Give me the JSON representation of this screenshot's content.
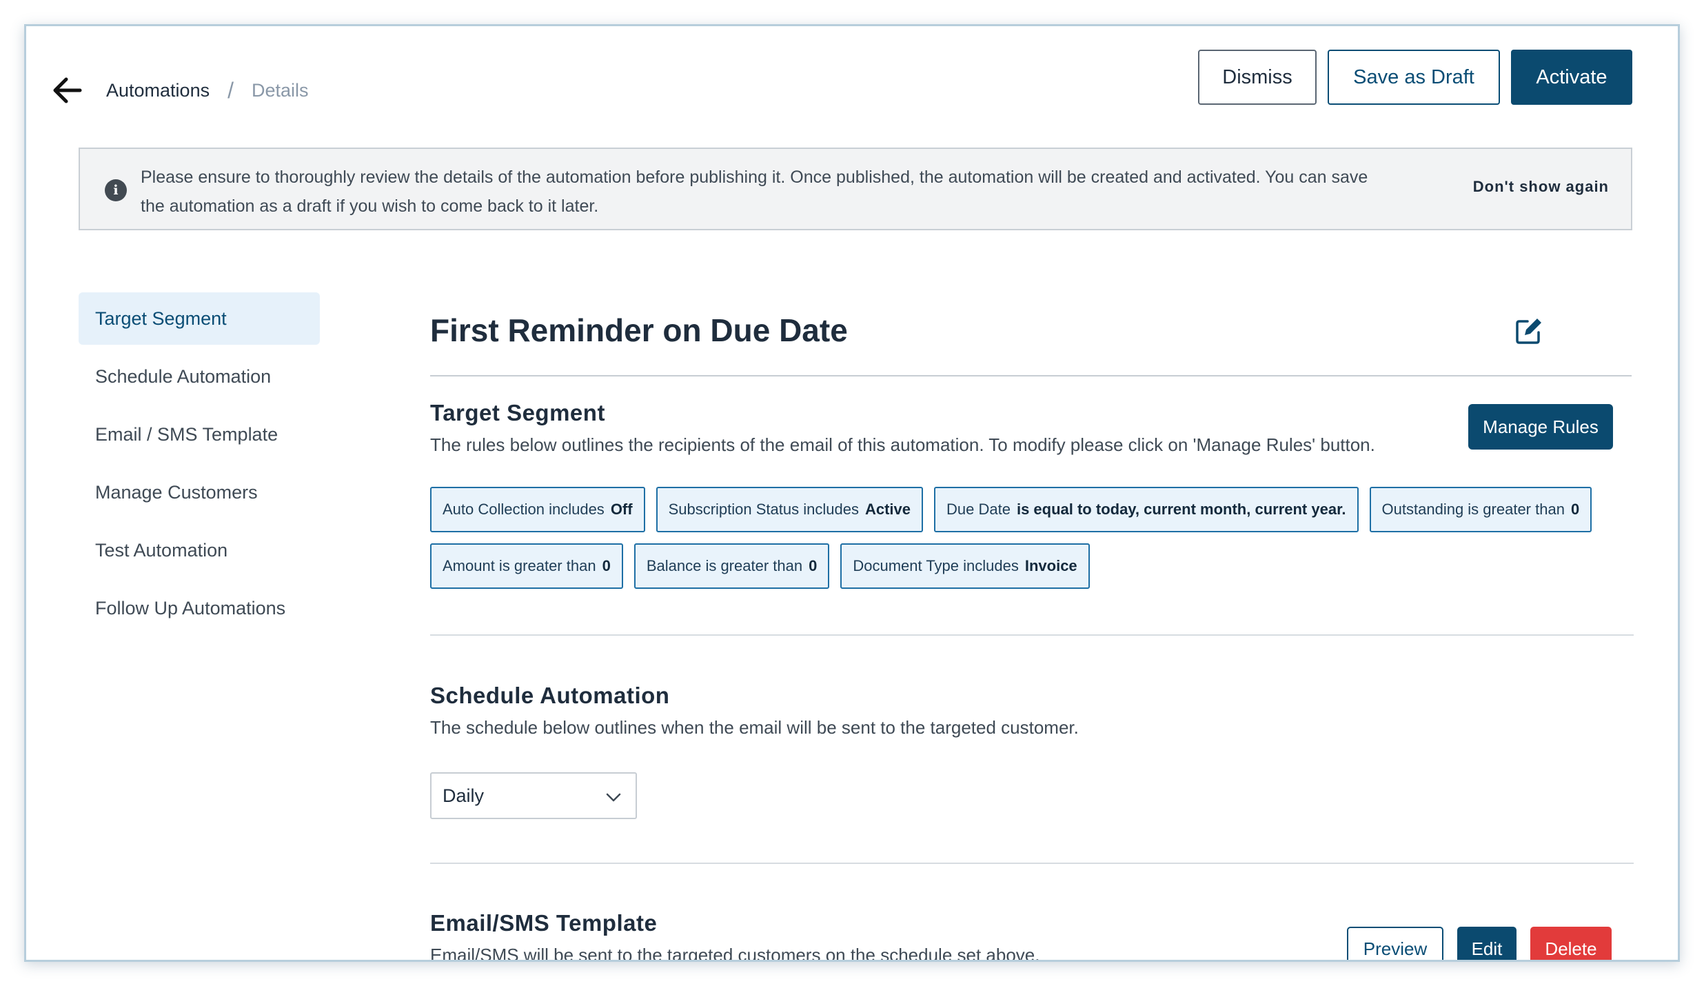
{
  "header": {
    "breadcrumb": {
      "parent": "Automations",
      "separator": "/",
      "current": "Details"
    },
    "buttons": {
      "dismiss": "Dismiss",
      "save_draft": "Save as Draft",
      "activate": "Activate"
    }
  },
  "banner": {
    "icon": "info-icon",
    "text": "Please ensure to thoroughly review the details of the automation before publishing it. Once published, the automation will be created and activated. You can save the automation as a draft if you wish to come back to it later.",
    "dismiss": "Don't show again"
  },
  "sidebar": {
    "items": [
      {
        "label": "Target Segment",
        "active": true
      },
      {
        "label": "Schedule Automation",
        "active": false
      },
      {
        "label": "Email / SMS Template",
        "active": false
      },
      {
        "label": "Manage Customers",
        "active": false
      },
      {
        "label": "Test Automation",
        "active": false
      },
      {
        "label": "Follow Up Automations",
        "active": false
      }
    ]
  },
  "main": {
    "title": "First Reminder on Due Date",
    "target_segment": {
      "title": "Target Segment",
      "description": "The rules below outlines the recipients of the email of this automation. To modify please click on 'Manage Rules' button.",
      "manage_rules": "Manage Rules",
      "rules": [
        {
          "label": "Auto Collection includes",
          "value": "Off"
        },
        {
          "label": "Subscription Status includes",
          "value": "Active"
        },
        {
          "label": "Due Date",
          "value": "is equal to today, current month, current year."
        },
        {
          "label": "Outstanding is greater than",
          "value": "0"
        },
        {
          "label": "Amount is greater than",
          "value": "0"
        },
        {
          "label": "Balance is greater than",
          "value": "0"
        },
        {
          "label": "Document Type includes",
          "value": "Invoice"
        }
      ]
    },
    "schedule": {
      "title": "Schedule Automation",
      "description": "The schedule below outlines when the email will be sent to the targeted customer.",
      "frequency": "Daily"
    },
    "template": {
      "title": "Email/SMS Template",
      "description": "Email/SMS will be sent to the targeted customers on the schedule set above.",
      "preview": "Preview",
      "edit": "Edit",
      "delete": "Delete"
    }
  },
  "colors": {
    "primary": "#0b4a6f",
    "danger": "#e23b3b",
    "chip_border": "#1e6fa5",
    "active_bg": "#e6f1fa"
  }
}
